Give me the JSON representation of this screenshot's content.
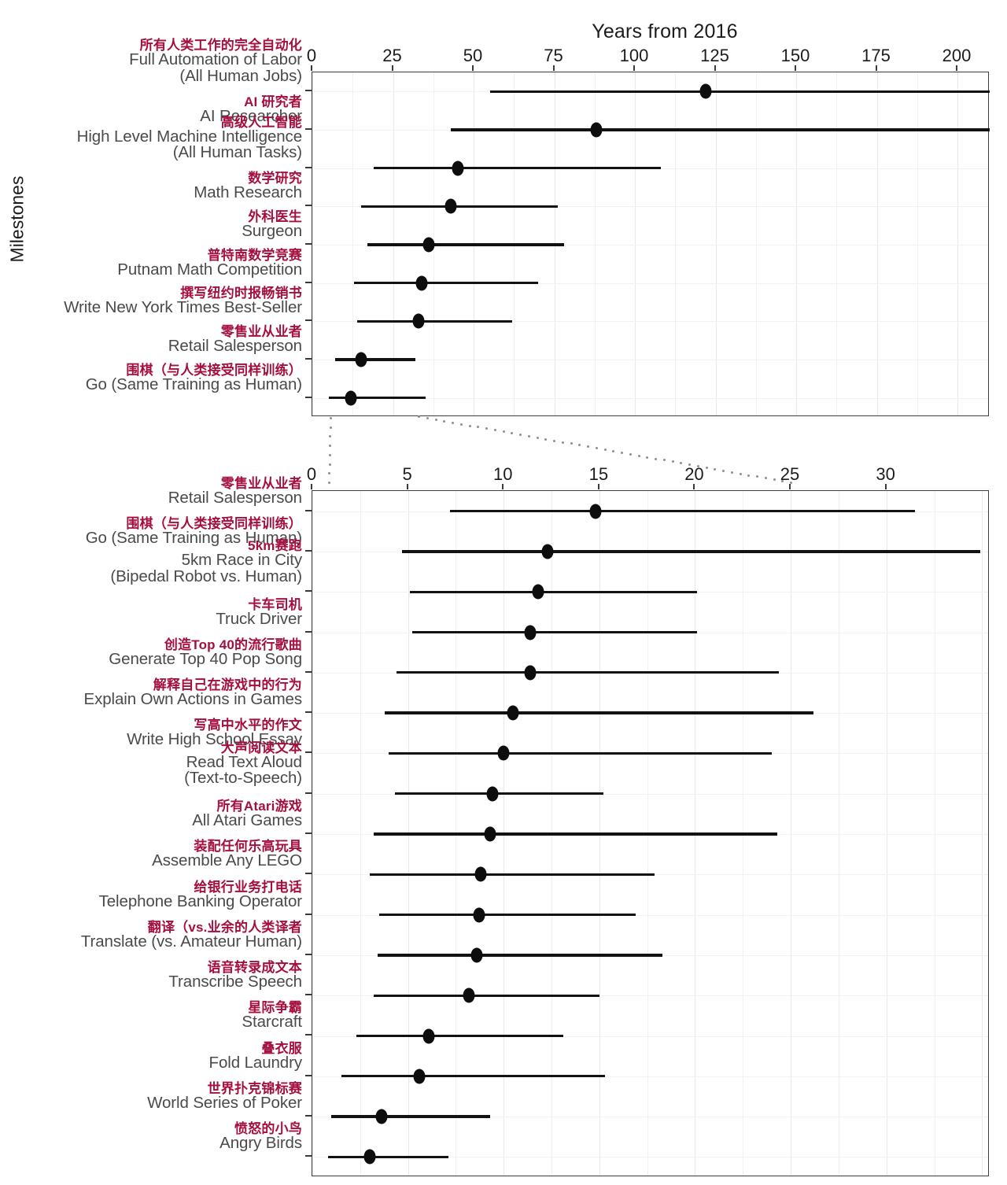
{
  "chart_data": {
    "type": "scatter",
    "title": "Years from 2016",
    "xlabel": "Years from 2016",
    "ylabel": "Milestones",
    "grid": true,
    "legend": "none",
    "panels": [
      {
        "name": "overview",
        "xlim": [
          0,
          210
        ],
        "xticks": [
          0,
          25,
          50,
          75,
          100,
          125,
          150,
          175,
          200
        ],
        "xticklabels": [
          "0",
          "25",
          "50",
          "75",
          "100",
          "125",
          "150",
          "175",
          "200"
        ],
        "rows": [
          {
            "cn": "所有人类工作的完全自动化",
            "en": "Full Automation of Labor",
            "en2": "(All Human Jobs)",
            "median": 122,
            "low": 55,
            "high": 210,
            "clipped_high": true
          },
          {
            "cn": "AI 研究者",
            "en": "AI Researcher",
            "en2": "",
            "median": 88,
            "low": 43,
            "high": 210,
            "clipped_high": true
          },
          {
            "cn": "高级人工智能",
            "en": "High Level Machine Intelligence",
            "en2": "(All Human Tasks)",
            "median": 45,
            "low": 19,
            "high": 108,
            "clipped_high": false
          },
          {
            "cn": "数学研究",
            "en": "Math Research",
            "en2": "",
            "median": 43,
            "low": 15,
            "high": 76,
            "clipped_high": false
          },
          {
            "cn": "外科医生",
            "en": "Surgeon",
            "en2": "",
            "median": 36,
            "low": 17,
            "high": 78,
            "clipped_high": false
          },
          {
            "cn": "普特南数学竞赛",
            "en": "Putnam Math Competition",
            "en2": "",
            "median": 34,
            "low": 13,
            "high": 70,
            "clipped_high": false
          },
          {
            "cn": "撰写纽约时报畅销书",
            "en": "Write New York Times Best-Seller",
            "en2": "",
            "median": 33,
            "low": 14,
            "high": 62,
            "clipped_high": false
          },
          {
            "cn": "零售业从业者",
            "en": "Retail Salesperson",
            "en2": "",
            "median": 15,
            "low": 7,
            "high": 32,
            "clipped_high": false
          },
          {
            "cn": "围棋（与人类接受同样训练）",
            "en": "Go (Same Training as Human)",
            "en2": "",
            "median": 12,
            "low": 5,
            "high": 35,
            "clipped_high": false
          }
        ]
      },
      {
        "name": "detail",
        "xlim": [
          0,
          35.4
        ],
        "xticks": [
          0,
          5,
          10,
          15,
          20,
          25,
          30
        ],
        "xticklabels": [
          "0",
          "5",
          "10",
          "15",
          "20",
          "25",
          "30"
        ],
        "rows": [
          {
            "cn": "零售业从业者",
            "en": "Retail Salesperson",
            "en2": "",
            "median": 14.8,
            "low": 7.2,
            "high": 31.5
          },
          {
            "cn": "围棋（与人类接受同样训练）",
            "en": "Go (Same Training as Human)",
            "en2": "",
            "median": 12.3,
            "low": 4.7,
            "high": 34.9
          },
          {
            "cn": "5km赛跑",
            "en": "5km Race in City",
            "en2": "(Bipedal Robot vs. Human)",
            "median": 11.8,
            "low": 5.1,
            "high": 20.1
          },
          {
            "cn": "卡车司机",
            "en": "Truck Driver",
            "en2": "",
            "median": 11.4,
            "low": 5.2,
            "high": 20.1
          },
          {
            "cn": "创造Top 40的流行歌曲",
            "en": "Generate Top 40 Pop Song",
            "en2": "",
            "median": 11.4,
            "low": 4.4,
            "high": 24.4
          },
          {
            "cn": "解释自己在游戏中的行为",
            "en": "Explain Own Actions in Games",
            "en2": "",
            "median": 10.5,
            "low": 3.8,
            "high": 26.2
          },
          {
            "cn": "写高中水平的作文",
            "en": "Write High School Essay",
            "en2": "",
            "median": 10.0,
            "low": 4.0,
            "high": 24.0
          },
          {
            "cn": "大声阅读文本",
            "en": "Read Text Aloud",
            "en2": "(Text-to-Speech)",
            "median": 9.4,
            "low": 4.3,
            "high": 15.2
          },
          {
            "cn": "所有Atari游戏",
            "en": "All Atari Games",
            "en2": "",
            "median": 9.3,
            "low": 3.2,
            "high": 24.3
          },
          {
            "cn": "装配任何乐高玩具",
            "en": "Assemble Any LEGO",
            "en2": "",
            "median": 8.8,
            "low": 3.0,
            "high": 17.9
          },
          {
            "cn": "给银行业务打电话",
            "en": "Telephone Banking Operator",
            "en2": "",
            "median": 8.7,
            "low": 3.5,
            "high": 16.9
          },
          {
            "cn": "翻译（vs.业余的人类译者",
            "en": "Translate (vs. Amateur Human)",
            "en2": "",
            "median": 8.6,
            "low": 3.4,
            "high": 18.3
          },
          {
            "cn": "语音转录成文本",
            "en": "Transcribe Speech",
            "en2": "",
            "median": 8.2,
            "low": 3.2,
            "high": 15.0
          },
          {
            "cn": "星际争霸",
            "en": "Starcraft",
            "en2": "",
            "median": 6.1,
            "low": 2.3,
            "high": 13.1
          },
          {
            "cn": "叠衣服",
            "en": "Fold Laundry",
            "en2": "",
            "median": 5.6,
            "low": 1.5,
            "high": 15.3
          },
          {
            "cn": "世界扑克锦标赛",
            "en": "World Series of Poker",
            "en2": "",
            "median": 3.6,
            "low": 1.0,
            "high": 9.3
          },
          {
            "cn": "愤怒的小鸟",
            "en": "Angry Birds",
            "en2": "",
            "median": 3.0,
            "low": 0.8,
            "high": 7.1
          }
        ]
      }
    ]
  },
  "colors": {
    "chinese_label": "#a50f3d",
    "english_label": "#4a4a4a",
    "mark": "#0d0d0d",
    "panel_border": "#3c3c3c",
    "grid": "#f0f0f0"
  }
}
